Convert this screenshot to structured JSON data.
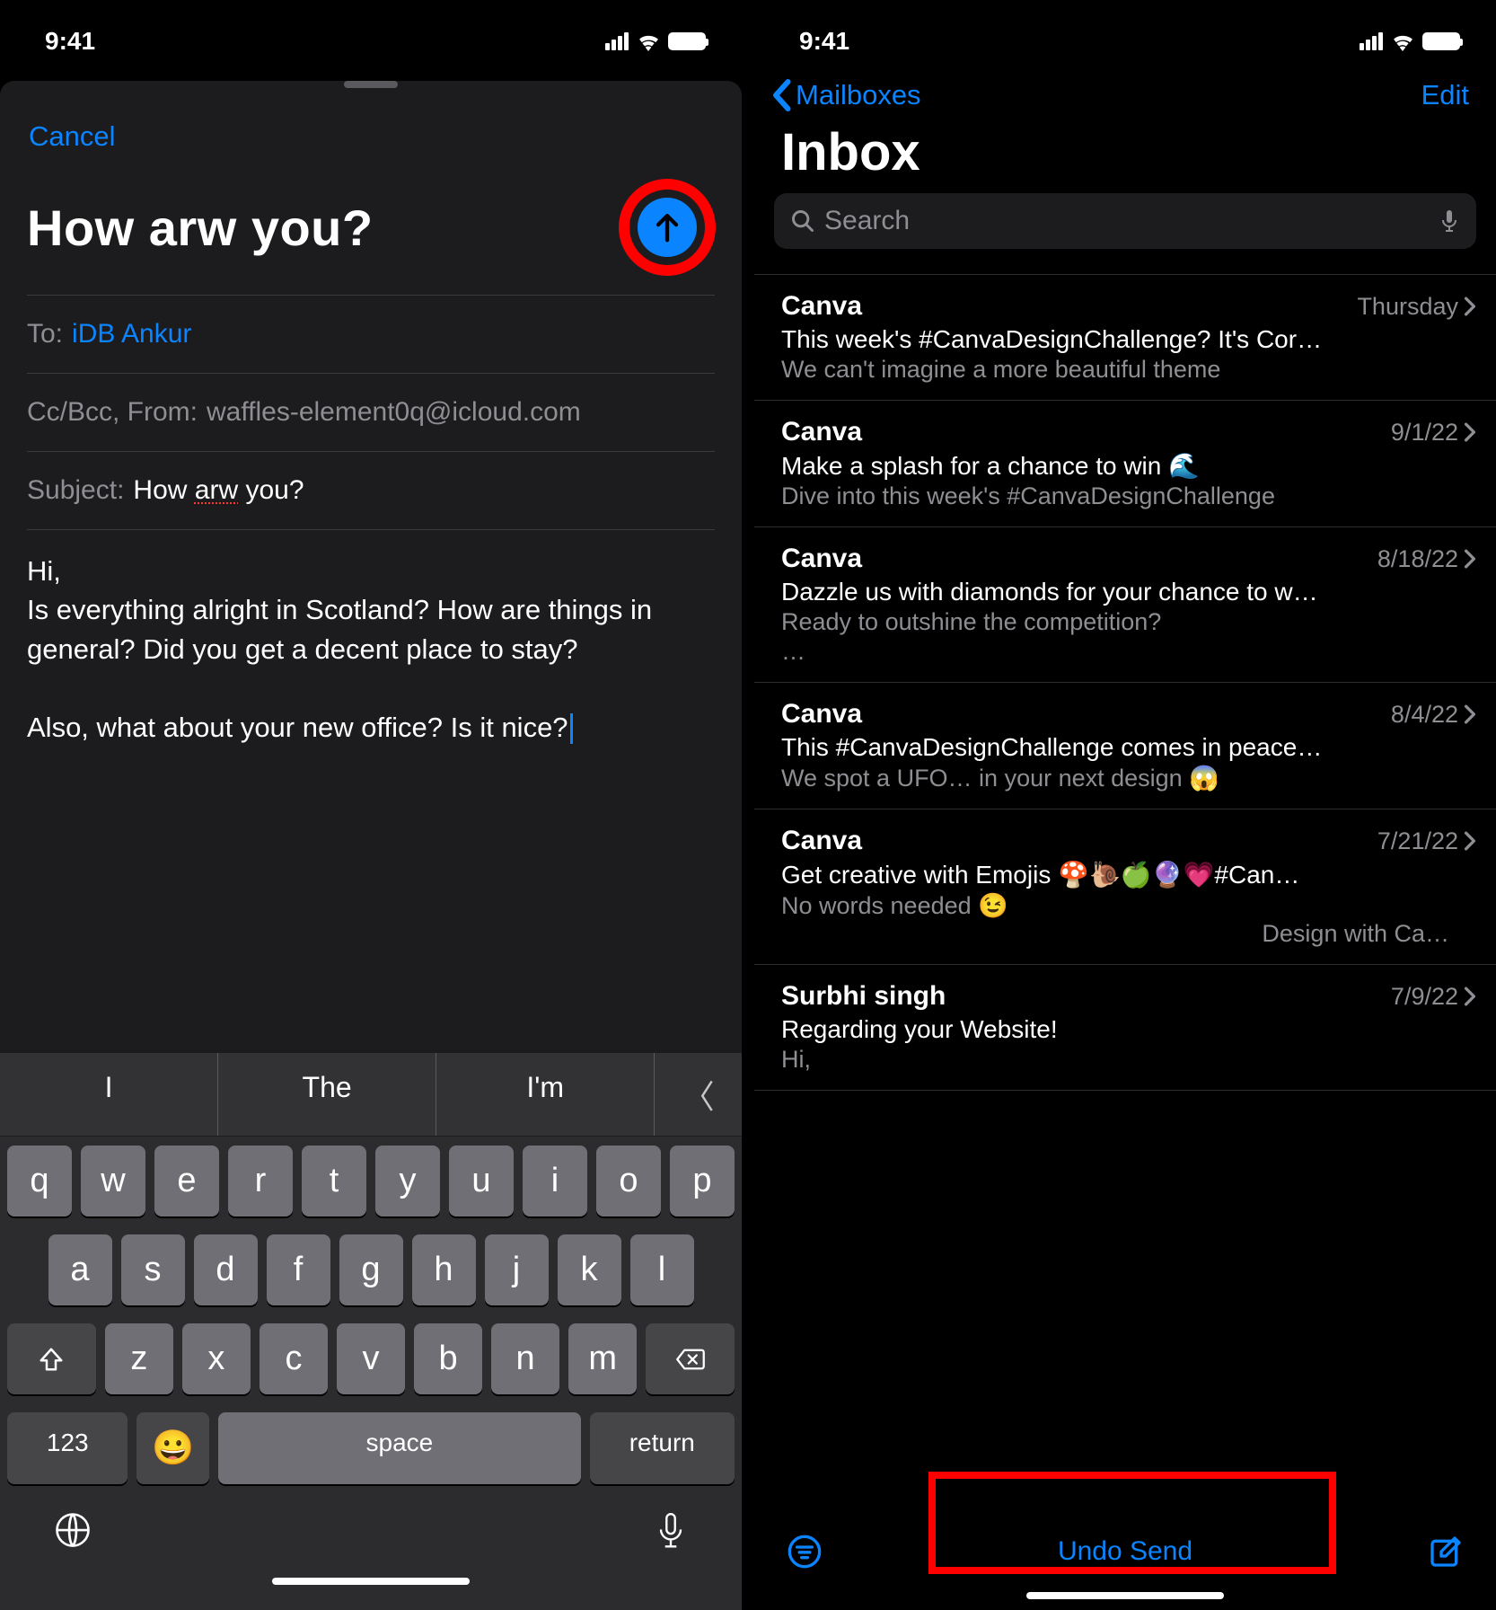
{
  "status": {
    "time": "9:41"
  },
  "compose": {
    "cancel": "Cancel",
    "title": "How arw you?",
    "to_label": "To:",
    "to_value": "iDB Ankur",
    "ccbcc_label": "Cc/Bcc, From:",
    "from_value": "waffles-element0q@icloud.com",
    "subject_label": "Subject:",
    "subject_prefix": "How ",
    "subject_typo": "arw",
    "subject_suffix": " you?",
    "body_line1": "Hi,",
    "body_line2": "Is everything alright in Scotland? How are things in general? Did you get a decent place to stay?",
    "body_line3": "Also, what about your new office? Is it nice?"
  },
  "keyboard": {
    "predictions": [
      "I",
      "The",
      "I'm"
    ],
    "row1": [
      "q",
      "w",
      "e",
      "r",
      "t",
      "y",
      "u",
      "i",
      "o",
      "p"
    ],
    "row2": [
      "a",
      "s",
      "d",
      "f",
      "g",
      "h",
      "j",
      "k",
      "l"
    ],
    "row3": [
      "z",
      "x",
      "c",
      "v",
      "b",
      "n",
      "m"
    ],
    "num": "123",
    "space": "space",
    "return": "return"
  },
  "inbox": {
    "back": "Mailboxes",
    "edit": "Edit",
    "title": "Inbox",
    "search_placeholder": "Search",
    "messages": [
      {
        "sender": "Canva",
        "date": "Thursday",
        "subject": "This week's #CanvaDesignChallenge? It's Cor…",
        "preview": "We can't imagine a more beautiful theme"
      },
      {
        "sender": "Canva",
        "date": "9/1/22",
        "subject": "Make a splash for a chance to win 🌊",
        "preview": "Dive into this week's #CanvaDesignChallenge"
      },
      {
        "sender": "Canva",
        "date": "8/18/22",
        "subject": "Dazzle us with diamonds for your chance to w…",
        "preview": "Ready to outshine the competition?",
        "preview_extra": "…"
      },
      {
        "sender": "Canva",
        "date": "8/4/22",
        "subject": "This #CanvaDesignChallenge comes in peace…",
        "preview": "We spot a UFO… in your next design 😱"
      },
      {
        "sender": "Canva",
        "date": "7/21/22",
        "subject": "Get creative with Emojis 🍄🐌🍏🔮💗#Can…",
        "preview": "No words needed 😉",
        "preview_right": "Design with Ca…"
      },
      {
        "sender": "Surbhi singh",
        "date": "7/9/22",
        "subject": "Regarding your Website!",
        "preview": "Hi,"
      }
    ],
    "undo_send": "Undo Send"
  }
}
